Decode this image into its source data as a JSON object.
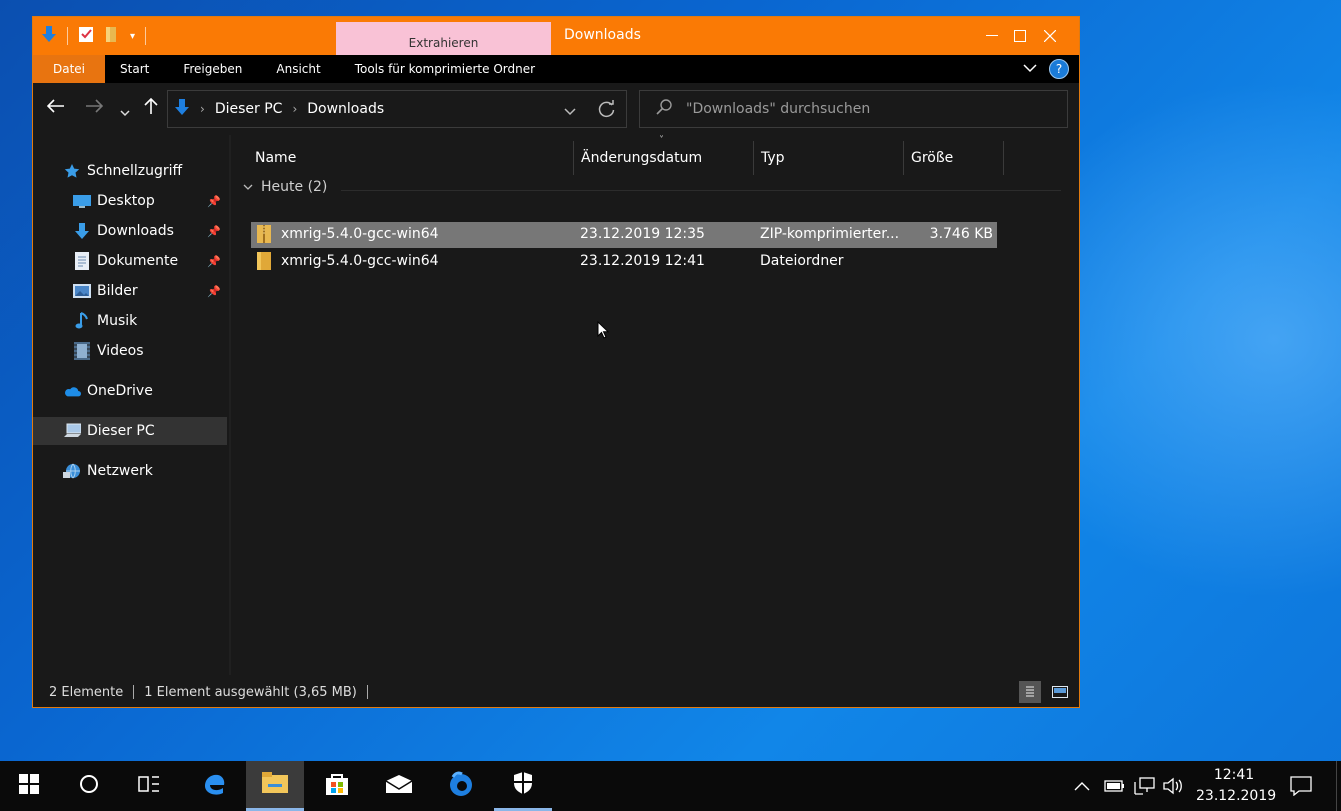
{
  "window": {
    "title": "Downloads",
    "context_tab": "Extrahieren",
    "ribbon_tabs": [
      "Datei",
      "Start",
      "Freigeben",
      "Ansicht",
      "Tools für komprimierte Ordner"
    ],
    "help": "?"
  },
  "address": {
    "path": [
      "Dieser PC",
      "Downloads"
    ],
    "search_placeholder": "\"Downloads\" durchsuchen"
  },
  "nav_pane": [
    {
      "label": "Schnellzugriff",
      "icon": "star-icon",
      "pinned": false
    },
    {
      "label": "Desktop",
      "icon": "desktop-icon",
      "pinned": true
    },
    {
      "label": "Downloads",
      "icon": "download-arrow-icon",
      "pinned": true
    },
    {
      "label": "Dokumente",
      "icon": "document-icon",
      "pinned": true
    },
    {
      "label": "Bilder",
      "icon": "pictures-icon",
      "pinned": true
    },
    {
      "label": "Musik",
      "icon": "music-note-icon",
      "pinned": false
    },
    {
      "label": "Videos",
      "icon": "video-icon",
      "pinned": false
    },
    {
      "label": "OneDrive",
      "icon": "cloud-icon",
      "pinned": false
    },
    {
      "label": "Dieser PC",
      "icon": "computer-icon",
      "pinned": false,
      "selected": true
    },
    {
      "label": "Netzwerk",
      "icon": "network-icon",
      "pinned": false
    }
  ],
  "columns": [
    "Name",
    "Änderungsdatum",
    "Typ",
    "Größe"
  ],
  "group": {
    "label": "Heute (2)"
  },
  "files": [
    {
      "name": "xmrig-5.4.0-gcc-win64",
      "date": "23.12.2019 12:35",
      "type": "ZIP-komprimierter...",
      "size": "3.746 KB",
      "icon": "zip-folder-icon",
      "selected": true
    },
    {
      "name": "xmrig-5.4.0-gcc-win64",
      "date": "23.12.2019 12:41",
      "type": "Dateiordner",
      "size": "",
      "icon": "folder-icon",
      "selected": false
    }
  ],
  "status": {
    "count": "2 Elemente",
    "selection": "1 Element ausgewählt (3,65 MB)"
  },
  "taskbar": {
    "time": "12:41",
    "date": "23.12.2019"
  },
  "colors": {
    "title_accent": "#fa7a05",
    "context_tab": "#f9c2d6",
    "window_bg": "#191919",
    "selection": "#777777"
  }
}
